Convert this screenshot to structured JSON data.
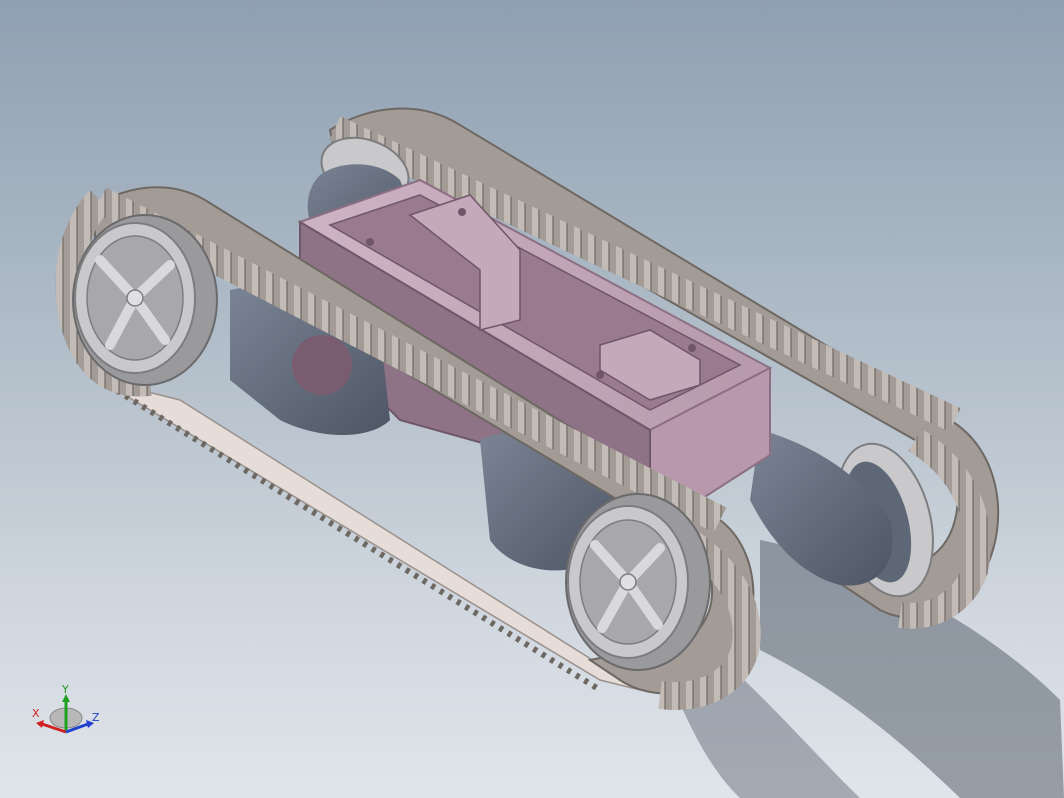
{
  "viewport": {
    "background_top": "#8fa0b2",
    "background_bottom": "#e0e5ea"
  },
  "model": {
    "colors": {
      "track": "#a39b96",
      "track_dark": "#6e6863",
      "track_light": "#cfc8c2",
      "chassis": "#b798ac",
      "chassis_dark": "#8c6f83",
      "chassis_light": "#cdb4c4",
      "side_plate": "#5e6776",
      "side_plate_light": "#7a8494",
      "wheel": "#9a9a9c",
      "wheel_light": "#c9c9cb",
      "track_band": "#e6dcd8"
    }
  },
  "triad": {
    "x_label": "X",
    "y_label": "Y",
    "z_label": "Z",
    "x_color": "#d02020",
    "y_color": "#20a020",
    "z_color": "#2040d0"
  }
}
